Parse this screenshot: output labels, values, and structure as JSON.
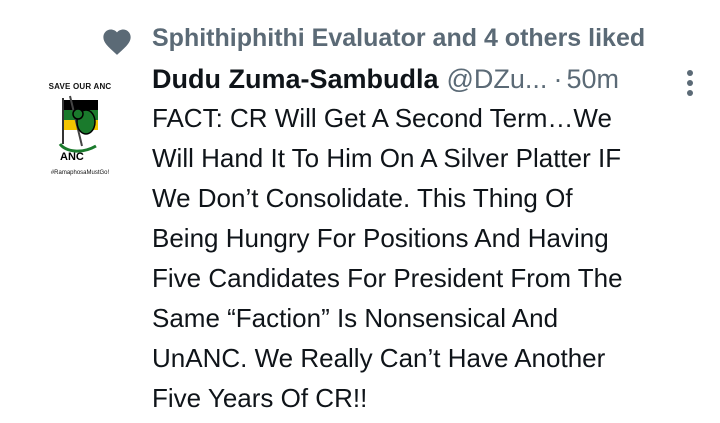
{
  "liked": {
    "icon": "heart-icon",
    "text": "Sphithiphithi Evaluator and 4 others liked"
  },
  "tweet": {
    "avatar": {
      "top_text": "SAVE OUR ANC",
      "logo_text": "ANC",
      "bottom_text": "#RamaphosaMustGo!"
    },
    "display_name": "Dudu Zuma-Sambudla",
    "handle": "@DZu...",
    "separator": "·",
    "time": "50m",
    "more_icon": "more-vertical-icon",
    "text": "FACT: CR Will Get A Second Term…We\nWill Hand It To Him On A Silver Platter IF\nWe Don’t Consolidate. This Thing Of\nBeing Hungry For Positions And Having\nFive Candidates For President From The\nSame “Faction” Is Nonsensical And\nUnANC. We Really Can’t Have Another\nFive Years Of CR!!"
  },
  "colors": {
    "secondary_text": "#5b6a76",
    "primary_text": "#0f1419",
    "anc_green": "#1a7a2c",
    "anc_yellow": "#f2c400",
    "anc_black": "#000000"
  }
}
